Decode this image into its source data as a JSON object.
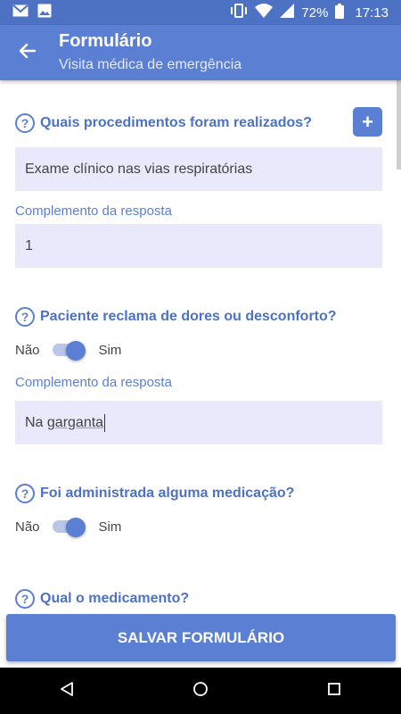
{
  "status_bar": {
    "battery": "72%",
    "time": "17:13",
    "icons": [
      "gmail-icon",
      "image-icon",
      "vibrate-icon",
      "wifi-icon",
      "signal-icon",
      "battery-icon"
    ]
  },
  "app_bar": {
    "title": "Formulário",
    "subtitle": "Visita médica de emergência"
  },
  "form": {
    "q1": {
      "text": "Quais procedimentos foram realizados?",
      "answer": "Exame clínico nas vias respiratórias",
      "complement_label": "Complemento da resposta",
      "complement_value": "1"
    },
    "q2": {
      "text": "Paciente reclama de dores ou desconforto?",
      "toggle_off_label": "Não",
      "toggle_on_label": "Sim",
      "toggle_value": true,
      "complement_label": "Complemento da resposta",
      "complement_value_prefix": "Na ",
      "complement_value_word": "garganta"
    },
    "q3": {
      "text": "Foi administrada alguma medicação?",
      "toggle_off_label": "Não",
      "toggle_on_label": "Sim",
      "toggle_value": true
    },
    "q4": {
      "text": "Qual o medicamento?"
    }
  },
  "save_button": {
    "label": "SALVAR FORMULÁRIO"
  },
  "colors": {
    "primary": "#5b7fd3",
    "field_bg": "#e8e9fb",
    "status_bar": "#4d72c4"
  }
}
